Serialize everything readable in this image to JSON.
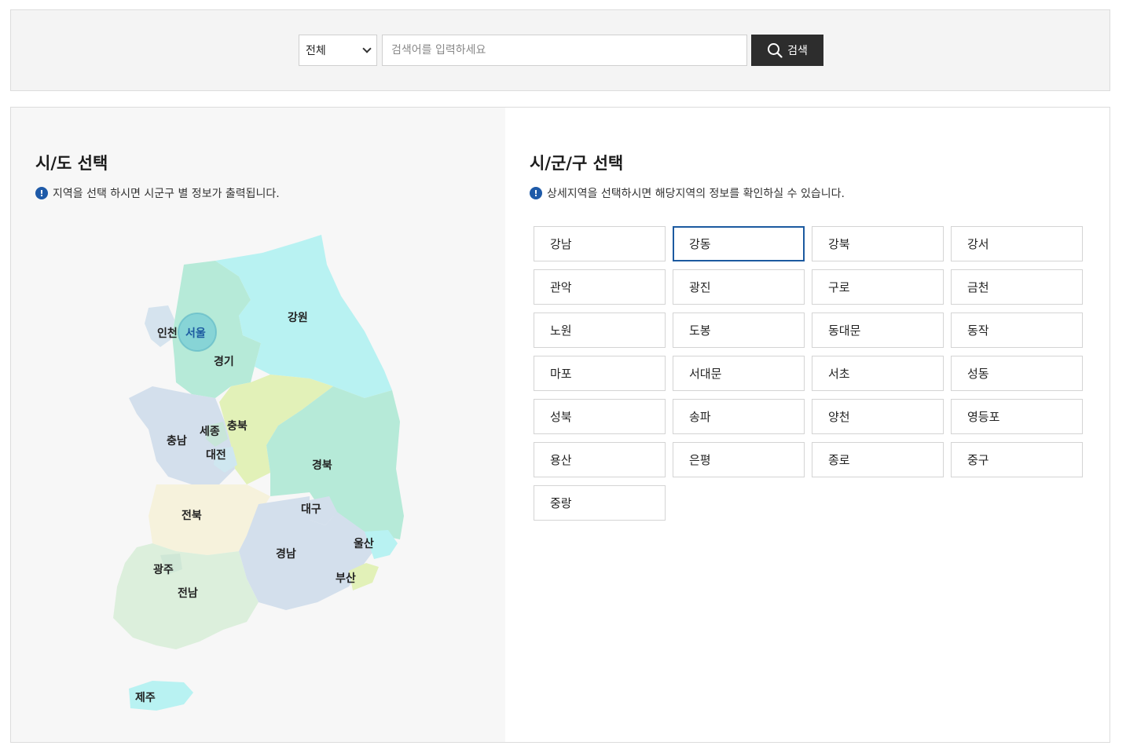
{
  "search": {
    "scope_selected": "전체",
    "placeholder": "검색어를 입력하세요",
    "button_label": "검색"
  },
  "left": {
    "title": "시/도 선택",
    "notice": "지역을 선택 하시면 시군구 별 정보가 출력됩니다.",
    "regions": [
      "인천",
      "서울",
      "강원",
      "경기",
      "충북",
      "세종",
      "충남",
      "대전",
      "경북",
      "대구",
      "전북",
      "울산",
      "경남",
      "부산",
      "광주",
      "전남",
      "제주"
    ],
    "selected_region": "서울"
  },
  "right": {
    "title": "시/군/구 선택",
    "notice": "상세지역을 선택하시면 해당지역의 정보를 확인하실 수 있습니다.",
    "districts": [
      "강남",
      "강동",
      "강북",
      "강서",
      "관악",
      "광진",
      "구로",
      "금천",
      "노원",
      "도봉",
      "동대문",
      "동작",
      "마포",
      "서대문",
      "서초",
      "성동",
      "성북",
      "송파",
      "양천",
      "영등포",
      "용산",
      "은평",
      "종로",
      "중구",
      "중랑"
    ],
    "selected_district": "강동"
  },
  "colors": {
    "selected_border": "#1c5aa0",
    "button_bg": "#2d2d2d",
    "info_icon": "#1e5aa8"
  },
  "icons": {
    "search": "search-icon",
    "notice": "info-icon",
    "dropdown": "chevron-down-icon"
  }
}
